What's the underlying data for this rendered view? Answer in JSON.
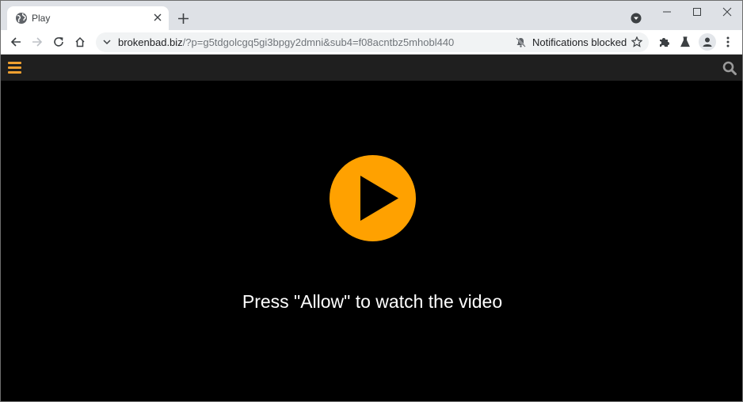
{
  "browser": {
    "tab": {
      "title": "Play",
      "favicon": "globe-icon",
      "close_icon": "close-icon"
    },
    "new_tab_icon": "plus-icon",
    "tab_search_icon": "tab-search-icon",
    "window_controls": [
      "minimize-icon",
      "maximize-icon",
      "close-icon"
    ],
    "nav": [
      "back-icon",
      "forward-icon",
      "reload-icon",
      "home-icon"
    ],
    "address_bar": {
      "host": "brokenbad.biz",
      "path": "/?p=g5tdgolcgq5gi3bpgy2dmni&sub4=f08acntbz5mhobl440",
      "notification_status": "Notifications blocked",
      "notification_icon": "bell-off-icon",
      "bookmark_icon": "star-icon"
    },
    "toolbar_icons": [
      "extensions-icon",
      "labs-icon",
      "profile-icon",
      "menu-kebab-icon"
    ]
  },
  "site": {
    "header": {
      "menu_icon": "hamburger-icon",
      "search_icon": "search-icon",
      "accent_color": "#f0a030"
    },
    "player": {
      "play_icon": "play-icon",
      "button_color": "#ffa100",
      "message": "Press \"Allow\" to watch the video"
    }
  }
}
